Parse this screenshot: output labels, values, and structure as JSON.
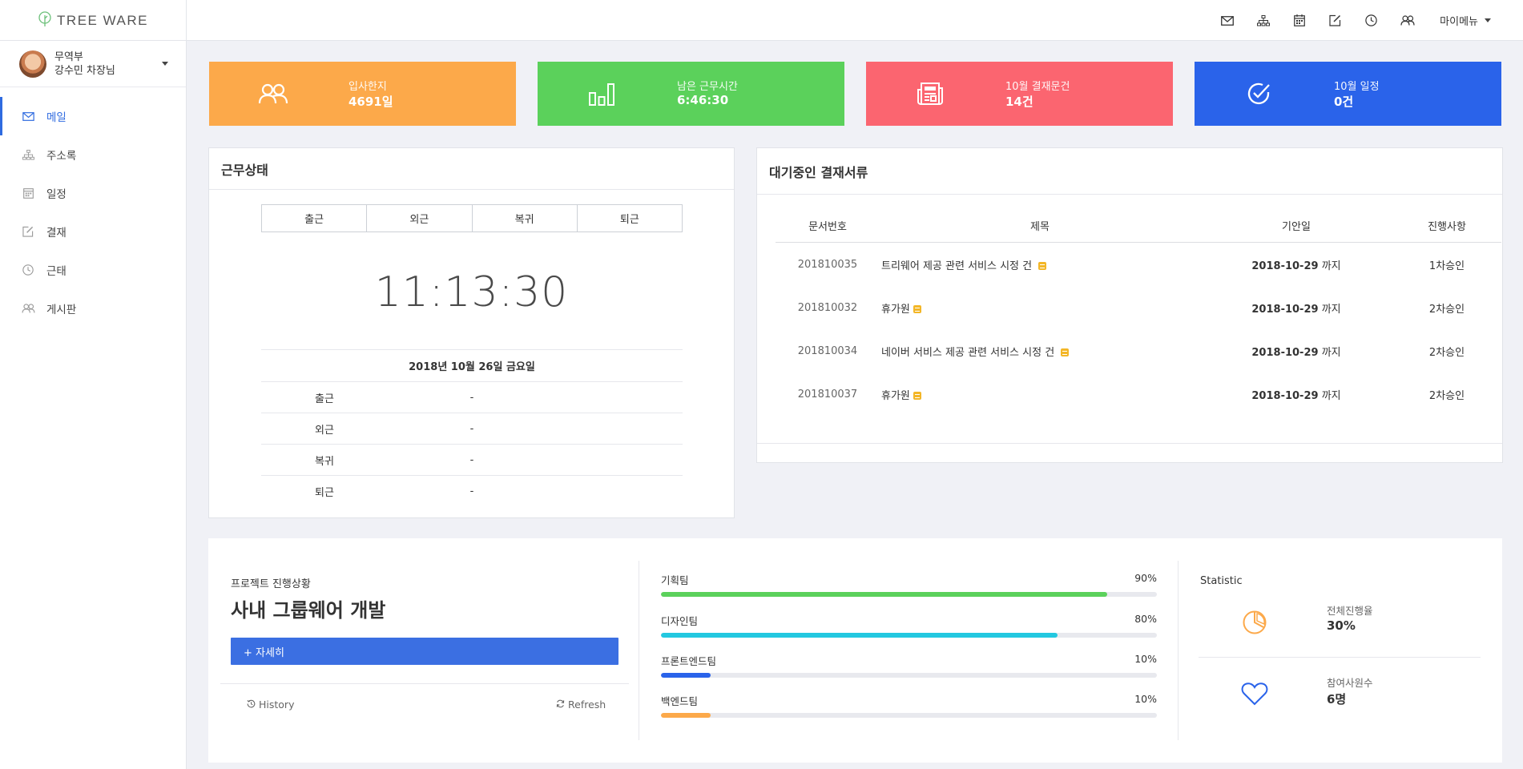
{
  "topbar": {
    "logo_text": "TREE WARE",
    "icons": [
      "mail-icon",
      "sitemap-icon",
      "calendar-icon",
      "edit-icon",
      "clock-icon",
      "users-icon"
    ],
    "my_menu": "마이메뉴"
  },
  "user": {
    "department": "무역부",
    "name": "강수민 차장님"
  },
  "sidebar": {
    "items": [
      {
        "label": "메일",
        "icon": "mail-icon",
        "active": true
      },
      {
        "label": "주소록",
        "icon": "sitemap-icon",
        "active": false
      },
      {
        "label": "일정",
        "icon": "calendar-icon",
        "active": false
      },
      {
        "label": "결재",
        "icon": "edit-icon",
        "active": false
      },
      {
        "label": "근태",
        "icon": "clock-icon",
        "active": false
      },
      {
        "label": "게시판",
        "icon": "users-icon",
        "active": false
      }
    ]
  },
  "cards": [
    {
      "label": "입사한지",
      "value": "4691일",
      "color": "#fca94a",
      "icon": "users-icon"
    },
    {
      "label": "남은 근무시간",
      "value": "6:46:30",
      "color": "#5bd15b",
      "icon": "bar-chart-icon"
    },
    {
      "label": "10월 결재문건",
      "value": "14건",
      "color": "#fb6570",
      "icon": "newspaper-icon"
    },
    {
      "label": "10월 일정",
      "value": "0건",
      "color": "#2a63ea",
      "icon": "check-circle-icon"
    }
  ],
  "work": {
    "title": "근무상태",
    "buttons": [
      "출근",
      "외근",
      "복귀",
      "퇴근"
    ],
    "clock": "11:13:30",
    "date": "2018년 10월 26일 금요일",
    "rows": [
      {
        "label": "출근",
        "value": "-"
      },
      {
        "label": "외근",
        "value": "-"
      },
      {
        "label": "복귀",
        "value": "-"
      },
      {
        "label": "퇴근",
        "value": "-"
      }
    ]
  },
  "approvals": {
    "title": "대기중인 결재서류",
    "headers": [
      "문서번호",
      "제목",
      "기안일",
      "진행사항"
    ],
    "rows": [
      {
        "no": "201810035",
        "title": "트리웨어 제공 관련 서비스 시정 건",
        "date": "2018-10-29",
        "date_suffix": "까지",
        "status": "1차승인"
      },
      {
        "no": "201810032",
        "title": "휴가원",
        "date": "2018-10-29",
        "date_suffix": "까지",
        "status": "2차승인"
      },
      {
        "no": "201810034",
        "title": "네이버 서비스 제공 관련 서비스 시정 건",
        "date": "2018-10-29",
        "date_suffix": "까지",
        "status": "2차승인"
      },
      {
        "no": "201810037",
        "title": "휴가원",
        "date": "2018-10-29",
        "date_suffix": "까지",
        "status": "2차승인"
      }
    ]
  },
  "project": {
    "subtitle": "프로젝트 진행상황",
    "title": "사내 그룹웨어 개발",
    "detail_button": "+ 자세히",
    "history": "History",
    "refresh": "Refresh",
    "teams": [
      {
        "name": "기획팀",
        "percent_label": "90%",
        "percent": 90,
        "color": "#5bd15b"
      },
      {
        "name": "디자인팀",
        "percent_label": "80%",
        "percent": 80,
        "color": "#23c8e0"
      },
      {
        "name": "프론트엔드팀",
        "percent_label": "10%",
        "percent": 10,
        "color": "#2a63ea"
      },
      {
        "name": "백엔드팀",
        "percent_label": "10%",
        "percent": 10,
        "color": "#fca94a"
      }
    ],
    "statistic": {
      "title": "Statistic",
      "items": [
        {
          "label": "전체진행율",
          "value": "30%",
          "icon": "pie-chart-icon",
          "color": "#fca94a"
        },
        {
          "label": "참여사원수",
          "value": "6명",
          "icon": "heart-icon",
          "color": "#2a63ea"
        }
      ]
    }
  }
}
